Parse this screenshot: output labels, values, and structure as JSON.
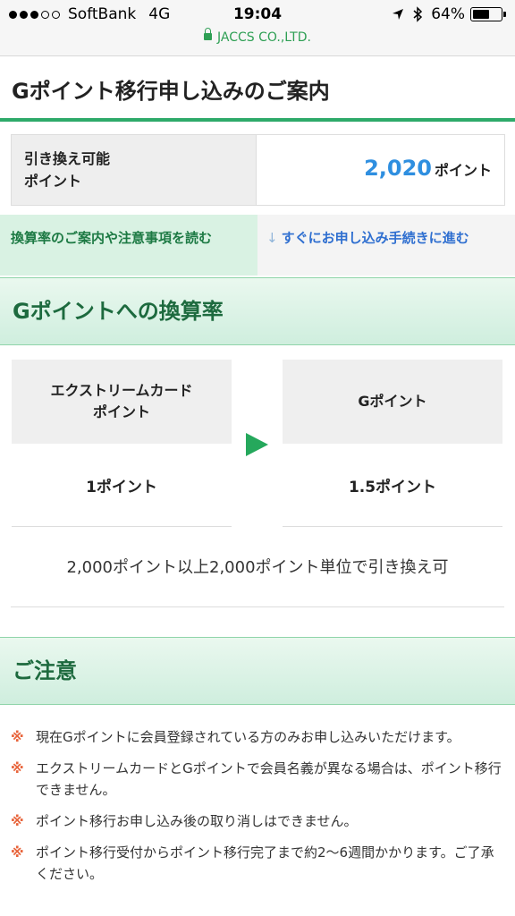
{
  "status_bar": {
    "carrier": "SoftBank",
    "network": "4G",
    "time": "19:04",
    "battery": "64%",
    "battery_level": 0.64,
    "icons": [
      "location-icon",
      "bluetooth-icon",
      "battery-icon"
    ]
  },
  "address_bar": {
    "domain": "JACCS CO.,LTD."
  },
  "page": {
    "title": "Gポイント移行申し込みのご案内"
  },
  "points": {
    "label": "引き換え可能\nポイント",
    "value": "2,020",
    "unit": "ポイント"
  },
  "nav": {
    "read_info": "換算率のご案内や注意事項を読む",
    "proceed": "すぐにお申し込み手続きに進む"
  },
  "rate_section": {
    "title": "Gポイントへの換算率",
    "from_label": "エクストリームカード\nポイント",
    "to_label": "Gポイント",
    "from_value": "1ポイント",
    "to_value": "1.5ポイント",
    "exchange_note": "2,000ポイント以上2,000ポイント単位で引き換え可"
  },
  "caution_section": {
    "title": "ご注意",
    "mark": "※",
    "items": [
      "現在Gポイントに会員登録されている方のみお申し込みいただけます。",
      "エクストリームカードとGポイントで会員名義が異なる場合は、ポイント移行できません。",
      "ポイント移行お申し込み後の取り消しはできません。",
      "ポイント移行受付からポイント移行完了まで約2〜6週間かかります。ご了承ください。"
    ]
  },
  "colors": {
    "accent_green": "#2eaa6a",
    "link_blue": "#2f6fd0",
    "points_blue": "#2f8fe0",
    "note_orange": "#e8643b"
  }
}
